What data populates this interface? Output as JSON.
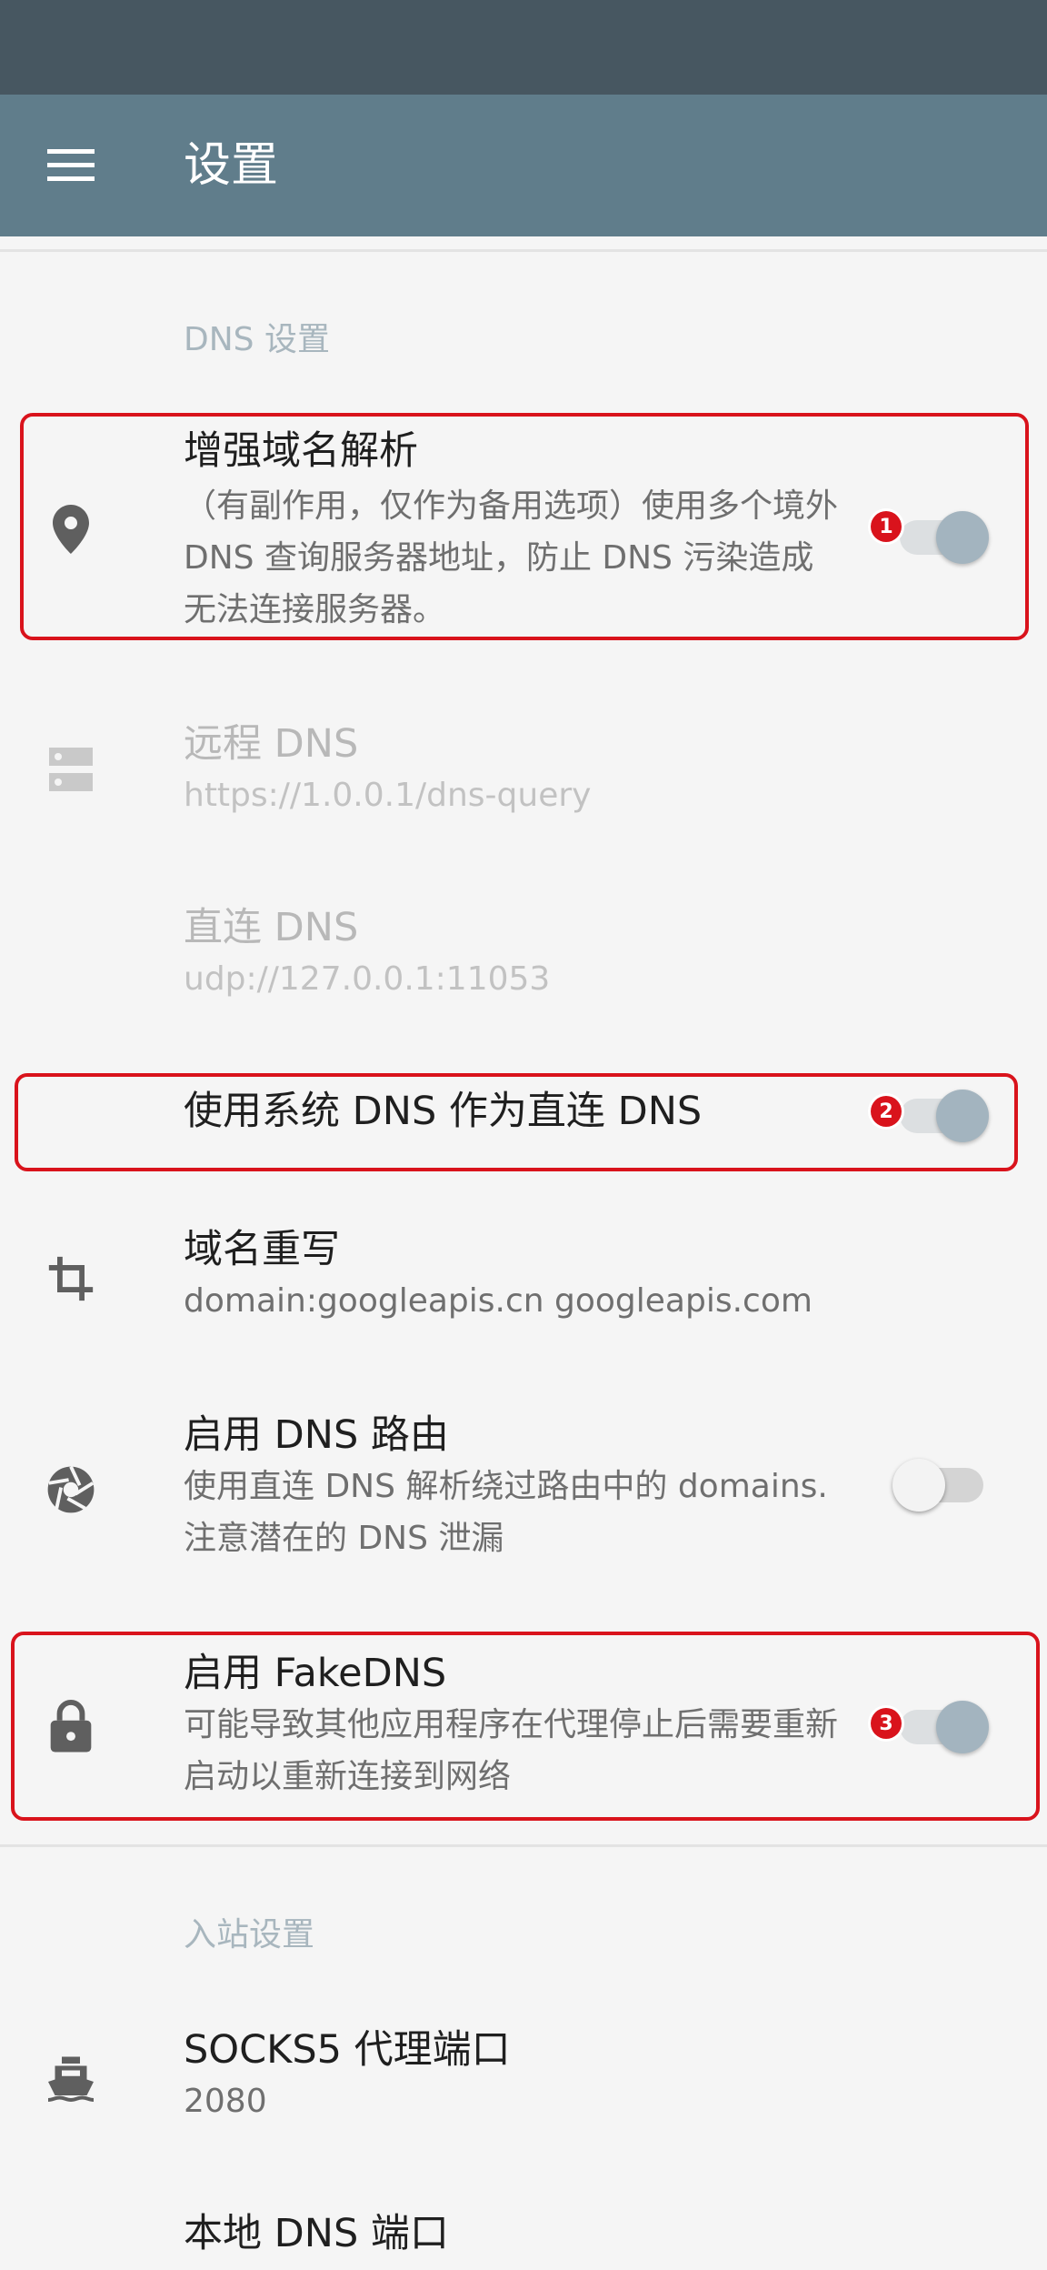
{
  "app_bar": {
    "title": "设置",
    "menu_icon": "menu-icon"
  },
  "sections": {
    "dns": {
      "header": "DNS 设置",
      "enhanced_dns": {
        "title": "增强域名解析",
        "summary": "（有副作用，仅作为备用选项）使用多个境外 DNS 查询服务器地址，防止 DNS 污染造成无法连接服务器。",
        "checked": true,
        "icon": "location-pin-icon",
        "badge": "1"
      },
      "remote_dns": {
        "title": "远程 DNS",
        "summary": "https://1.0.0.1/dns-query",
        "icon": "dns-server-icon"
      },
      "direct_dns": {
        "title": "直连 DNS",
        "summary": "udp://127.0.0.1:11053"
      },
      "system_dns": {
        "title": "使用系统 DNS 作为直连 DNS",
        "checked": true,
        "badge": "2"
      },
      "domain_rewrite": {
        "title": "域名重写",
        "summary": "domain:googleapis.cn googleapis.com",
        "icon": "crop-icon"
      },
      "dns_routing": {
        "title": "启用 DNS 路由",
        "summary": "使用直连 DNS 解析绕过路由中的 domains. 注意潜在的 DNS 泄漏",
        "checked": false,
        "icon": "shutter-icon"
      },
      "fake_dns": {
        "title": "启用 FakeDNS",
        "summary": "可能导致其他应用程序在代理停止后需要重新启动以重新连接到网络",
        "checked": true,
        "icon": "lock-icon",
        "badge": "3"
      }
    },
    "inbound": {
      "header": "入站设置",
      "socks_port": {
        "title": "SOCKS5 代理端口",
        "summary": "2080",
        "icon": "ship-icon"
      },
      "local_dns_port": {
        "title": "本地 DNS 端口"
      }
    }
  },
  "colors": {
    "status_bar": "#475761",
    "app_bar": "#607d8b",
    "highlight": "#d9131c",
    "switch_thumb_on": "#a3b4bf"
  }
}
